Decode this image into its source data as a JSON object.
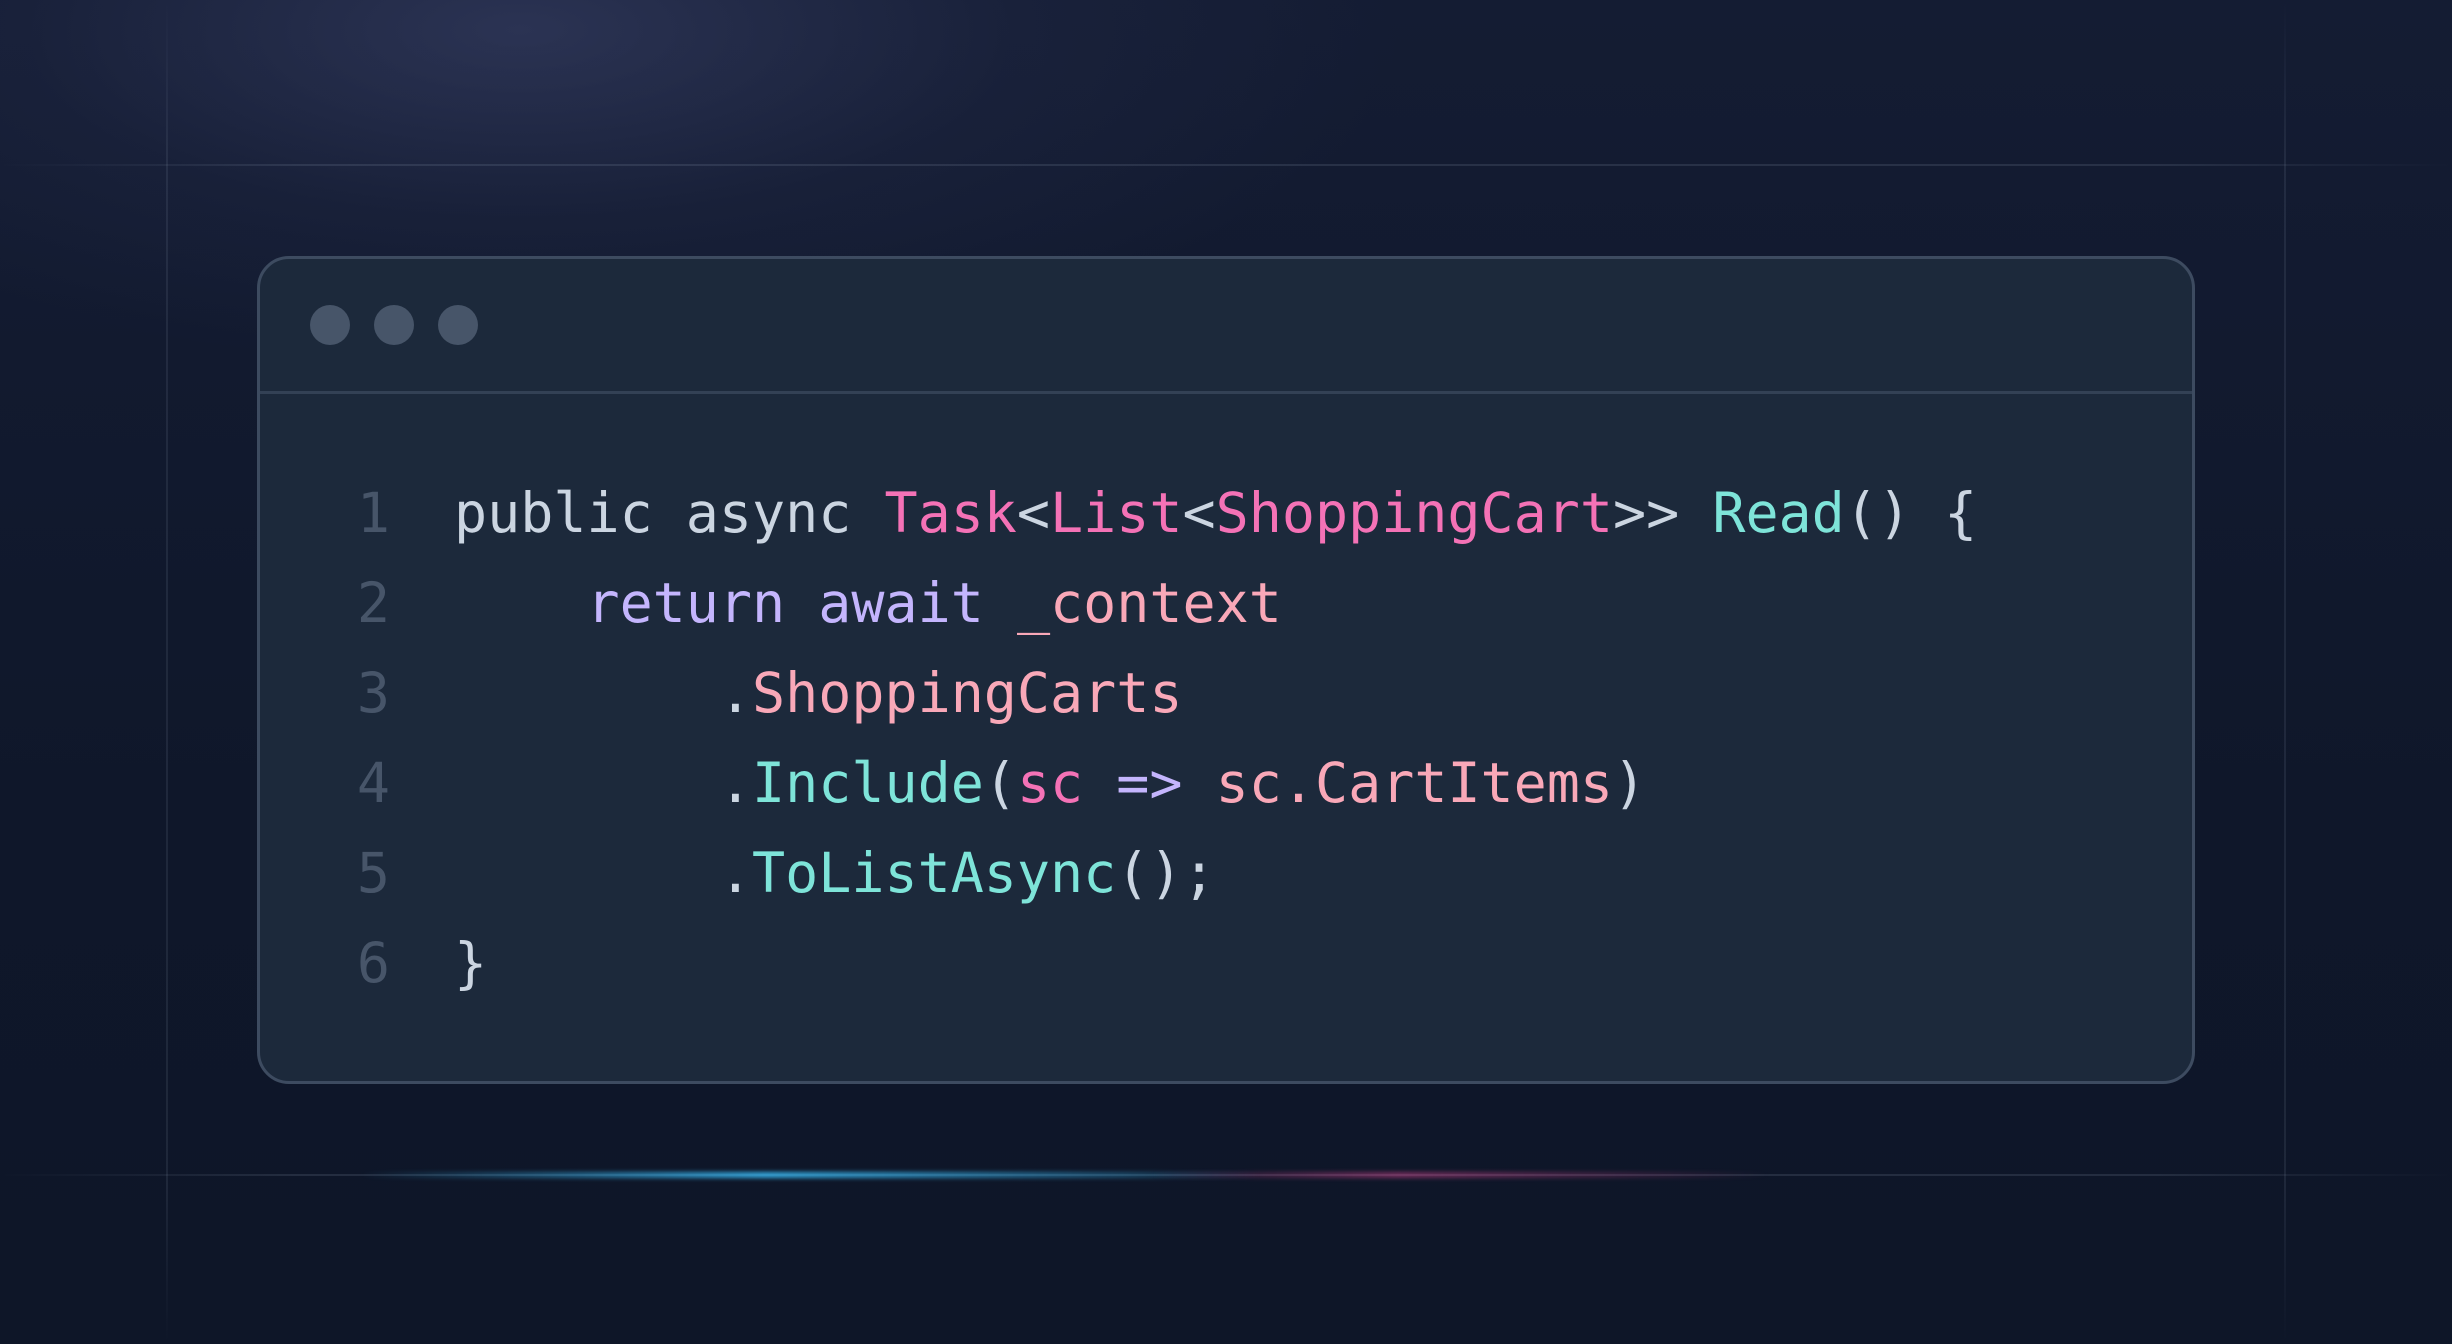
{
  "editor": {
    "lines": [
      {
        "number": "1",
        "tokens": [
          {
            "text": "public async ",
            "kind": "default"
          },
          {
            "text": "Task",
            "kind": "type"
          },
          {
            "text": "<",
            "kind": "default"
          },
          {
            "text": "List",
            "kind": "type"
          },
          {
            "text": "<",
            "kind": "default"
          },
          {
            "text": "ShoppingCart",
            "kind": "type"
          },
          {
            "text": ">> ",
            "kind": "default"
          },
          {
            "text": "Read",
            "kind": "method"
          },
          {
            "text": "() {",
            "kind": "default"
          }
        ]
      },
      {
        "number": "2",
        "tokens": [
          {
            "text": "    ",
            "kind": "default"
          },
          {
            "text": "return await",
            "kind": "keyword"
          },
          {
            "text": " ",
            "kind": "default"
          },
          {
            "text": "_context",
            "kind": "member"
          }
        ]
      },
      {
        "number": "3",
        "tokens": [
          {
            "text": "        .",
            "kind": "default"
          },
          {
            "text": "ShoppingCarts",
            "kind": "member"
          }
        ]
      },
      {
        "number": "4",
        "tokens": [
          {
            "text": "        .",
            "kind": "default"
          },
          {
            "text": "Include",
            "kind": "method"
          },
          {
            "text": "(",
            "kind": "default"
          },
          {
            "text": "sc",
            "kind": "param"
          },
          {
            "text": " ",
            "kind": "default"
          },
          {
            "text": "=>",
            "kind": "op"
          },
          {
            "text": " ",
            "kind": "default"
          },
          {
            "text": "sc.CartItems",
            "kind": "member"
          },
          {
            "text": ")",
            "kind": "default"
          }
        ]
      },
      {
        "number": "5",
        "tokens": [
          {
            "text": "        .",
            "kind": "default"
          },
          {
            "text": "ToListAsync",
            "kind": "method"
          },
          {
            "text": "();",
            "kind": "default"
          }
        ]
      },
      {
        "number": "6",
        "tokens": [
          {
            "text": "}",
            "kind": "default"
          }
        ]
      }
    ]
  },
  "colors": {
    "background": "#0f172a",
    "window": "#1c293b",
    "border": "#3d4b60",
    "dot": "#475569",
    "line_number": "#475569",
    "default": "#cbd5e1",
    "type": "#f472b6",
    "method": "#7ee4d9",
    "keyword": "#c4b5fd",
    "member": "#f9a8b8",
    "param": "#f472b6",
    "op": "#c4b5fd"
  }
}
